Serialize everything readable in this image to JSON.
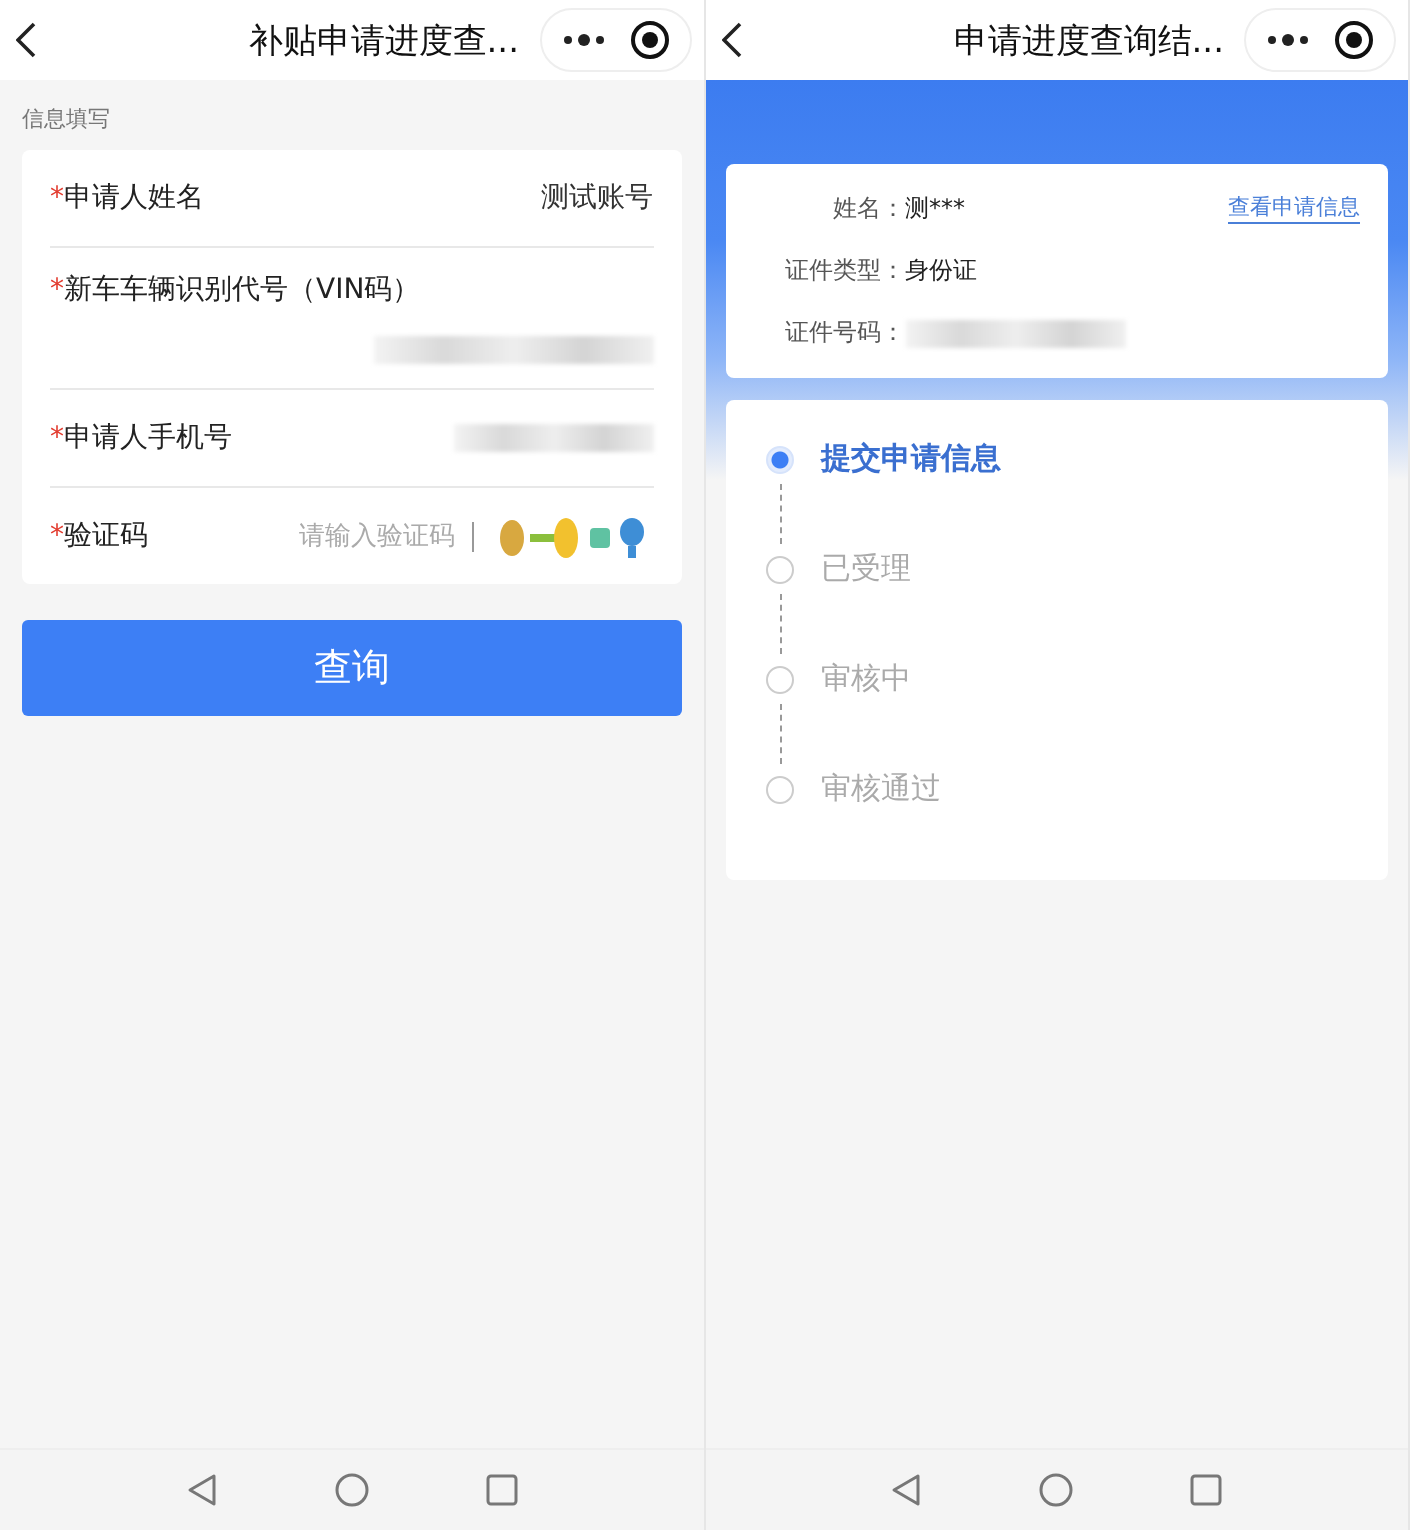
{
  "form_screen": {
    "title": "补贴申请进度查...",
    "section_label": "信息填写",
    "fields": [
      {
        "kind": "text",
        "required_mark": "*",
        "label": "申请人姓名",
        "value": "测试账号"
      },
      {
        "kind": "masked_block",
        "required_mark": "*",
        "label": "新车车辆识别代号（VIN码）"
      },
      {
        "kind": "masked",
        "required_mark": "*",
        "label": "申请人手机号"
      },
      {
        "kind": "captcha",
        "required_mark": "*",
        "label": "验证码",
        "placeholder": "请输入验证码"
      }
    ],
    "submit": "查询"
  },
  "result_screen": {
    "title": "申请进度查询结...",
    "info": [
      {
        "kind": "text",
        "label": "姓名：",
        "value": "测***"
      },
      {
        "kind": "text",
        "label": "证件类型：",
        "value": "身份证"
      },
      {
        "kind": "masked",
        "label": "证件号码："
      }
    ],
    "info_link": "查看申请信息",
    "steps": [
      {
        "label": "提交申请信息",
        "selected": true
      },
      {
        "label": "已受理",
        "selected": false
      },
      {
        "label": "审核中",
        "selected": false
      },
      {
        "label": "审核通过",
        "selected": false
      }
    ]
  }
}
